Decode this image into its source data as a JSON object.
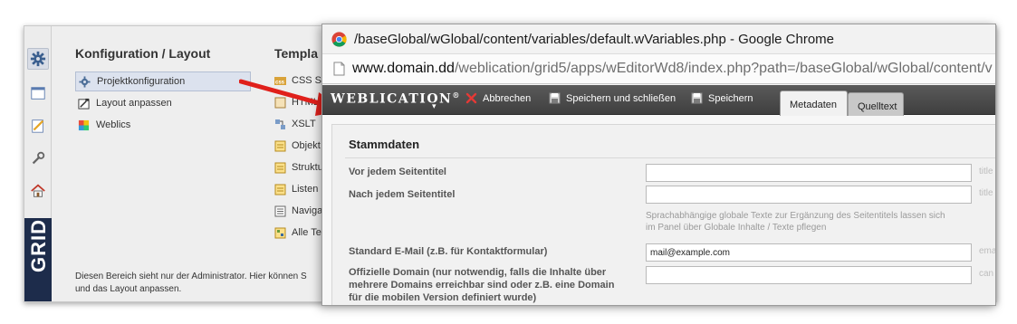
{
  "background_app": {
    "konfiguration": {
      "title": "Konfiguration / Layout",
      "items": [
        {
          "label": "Projektkonfiguration",
          "icon": "gear-icon",
          "active": true
        },
        {
          "label": "Layout anpassen",
          "icon": "layout-icon"
        },
        {
          "label": "Weblics",
          "icon": "weblics-icon"
        }
      ]
    },
    "templates": {
      "title": "Templa",
      "items": [
        {
          "label": "CSS S",
          "icon": "css-icon"
        },
        {
          "label": "HTML",
          "icon": "html-icon"
        },
        {
          "label": "XSLT",
          "icon": "xslt-icon"
        },
        {
          "label": "Objekt",
          "icon": "object-icon"
        },
        {
          "label": "Struktu",
          "icon": "structure-icon"
        },
        {
          "label": "Listen",
          "icon": "list-icon"
        },
        {
          "label": "Naviga",
          "icon": "navigation-icon"
        },
        {
          "label": "Alle Te",
          "icon": "all-templates-icon"
        }
      ]
    },
    "footer_line1": "Diesen Bereich sieht nur der Administrator. Hier können S",
    "footer_line2": "und das Layout anpassen.",
    "rail_logo": "GRID"
  },
  "chrome": {
    "window_title": "/baseGlobal/wGlobal/content/variables/default.wVariables.php - Google Chrome",
    "url_host": "www.domain.dd",
    "url_path": "/weblication/grid5/apps/wEditorWd8/index.php?path=/baseGlobal/wGlobal/content/v"
  },
  "toolbar": {
    "brand": "WEBLICATION",
    "brand_mark": "®",
    "cancel_label": "Abbrechen",
    "save_close_label": "Speichern und schließen",
    "save_label": "Speichern",
    "tabs": [
      {
        "label": "Metadaten",
        "active": true
      },
      {
        "label": "Quelltext",
        "active": false
      }
    ]
  },
  "form": {
    "section_title": "Stammdaten",
    "fields": [
      {
        "label": "Vor jedem Seitentitel",
        "value": "",
        "suffix": "title"
      },
      {
        "label": "Nach jedem Seitentitel",
        "value": "",
        "suffix": "title"
      },
      {
        "label": "Standard E-Mail (z.B. für Kontaktformular)",
        "value": "mail@example.com",
        "suffix": "ema"
      },
      {
        "label_lines": [
          "Offizielle Domain (nur notwendig, falls die Inhalte über",
          "mehrere Domains erreichbar sind oder z.B. eine Domain",
          "für die mobilen Version definiert wurde)"
        ],
        "value": "",
        "suffix": "can"
      }
    ],
    "hint_line1": "Sprachabhängige globale Texte zur Ergänzung des Seitentitels lassen sich",
    "hint_line2": "im Panel über Globale Inhalte / Texte pflegen"
  },
  "colors": {
    "toolbar_bg": "#4a4a4a",
    "active_item_bg": "#dce2ee",
    "arrow": "#e0201b",
    "rail_logo_bg": "#1d2c4b"
  }
}
